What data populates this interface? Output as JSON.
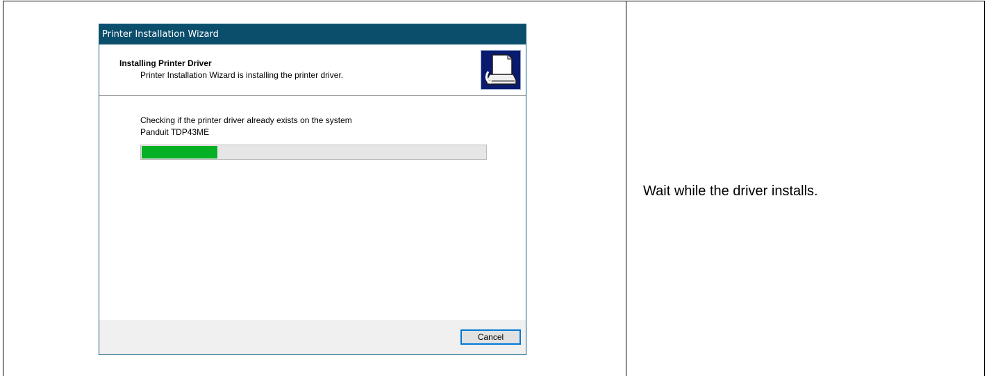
{
  "wizard": {
    "title": "Printer Installation Wizard",
    "header_title": "Installing Printer Driver",
    "header_subtitle": "Printer Installation Wizard is installing the printer driver.",
    "status_text": "Checking if the printer driver already exists on the system",
    "printer_name": "Panduit TDP43ME",
    "progress": 0.22,
    "cancel_label": "Cancel",
    "icon": "printer-install-icon"
  },
  "instruction": {
    "text": "Wait while the driver installs."
  },
  "colors": {
    "titlebar": "#0b4e6c",
    "progress_fill": "#06b025",
    "button_focus": "#0078d7"
  }
}
